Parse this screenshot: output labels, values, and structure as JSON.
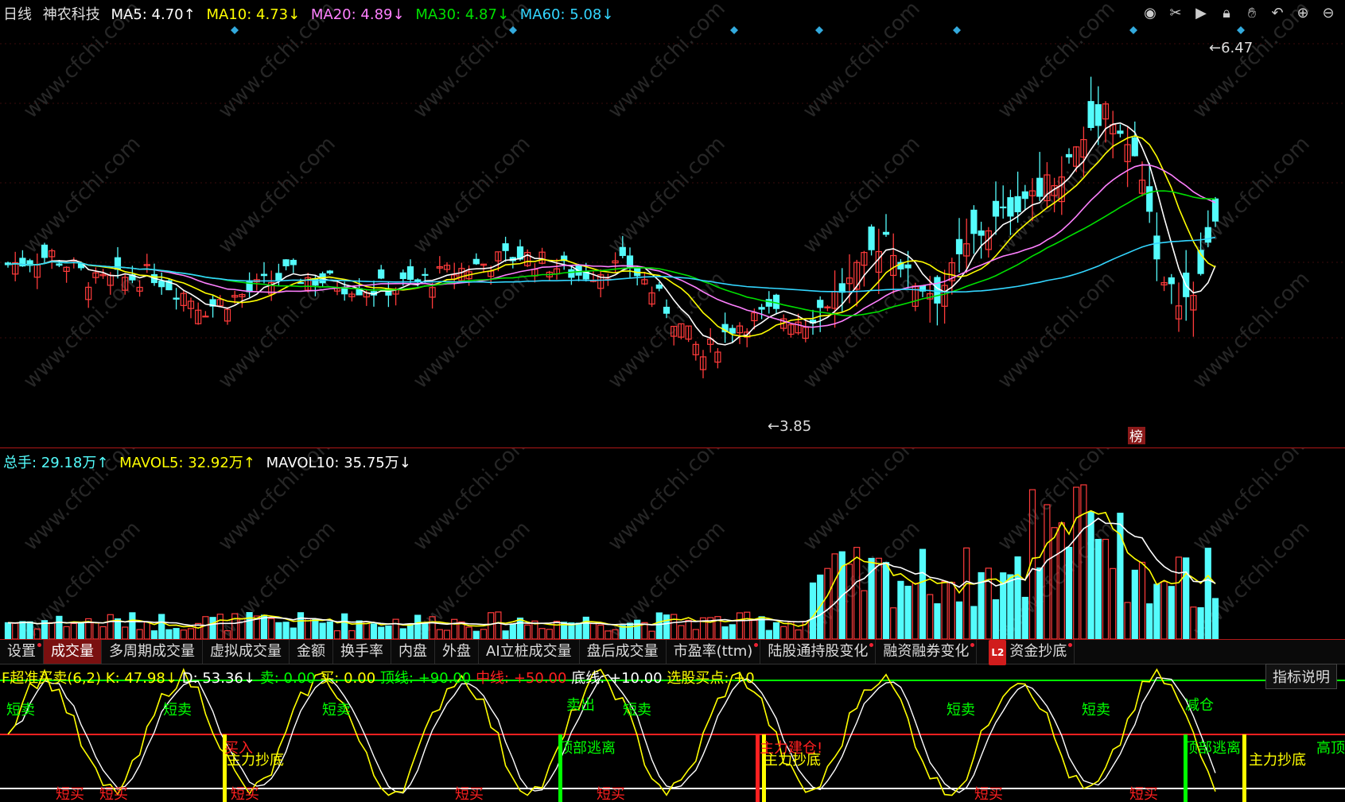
{
  "price_header": {
    "period": "日线",
    "stock_name": "神农科技",
    "ma5": "MA5: 4.70↑",
    "ma10": "MA10: 4.73↓",
    "ma20": "MA20: 4.89↓",
    "ma30": "MA30: 4.87↓",
    "ma60": "MA60: 5.08↓"
  },
  "price_annotations": {
    "high": "6.47",
    "low": "3.85",
    "badge": "榜"
  },
  "volume_header": {
    "total": "总手: 29.18万↑",
    "mavol5": "MAVOL5: 32.92万↑",
    "mavol10": "MAVOL10: 35.75万↓"
  },
  "toolbar_icons": [
    "eye-icon",
    "scissors-icon",
    "play-icon",
    "lock-icon",
    "hand-icon",
    "undo-icon",
    "zoom-in-icon",
    "zoom-out-icon"
  ],
  "tabs": [
    {
      "label": "设置",
      "dot": true,
      "active": false
    },
    {
      "label": "成交量",
      "dot": false,
      "active": true
    },
    {
      "label": "多周期成交量",
      "dot": false,
      "active": false
    },
    {
      "label": "虚拟成交量",
      "dot": false,
      "active": false
    },
    {
      "label": "金额",
      "dot": false,
      "active": false
    },
    {
      "label": "换手率",
      "dot": false,
      "active": false
    },
    {
      "label": "内盘",
      "dot": false,
      "active": false
    },
    {
      "label": "外盘",
      "dot": false,
      "active": false
    },
    {
      "label": "AI立桩成交量",
      "dot": false,
      "active": false
    },
    {
      "label": "盘后成交量",
      "dot": false,
      "active": false
    },
    {
      "label": "市盈率(ttm)",
      "dot": true,
      "active": false
    },
    {
      "label": "陆股通持股变化",
      "dot": true,
      "active": false
    },
    {
      "label": "融资融券变化",
      "dot": true,
      "active": false
    },
    {
      "label": "资金抄底",
      "dot": true,
      "active": false,
      "l2": true
    }
  ],
  "indicator_header": {
    "name": "F超准买卖(6,2)",
    "k": "K: 47.98↓",
    "d": "D: 53.36↓",
    "sell": "卖: 0.00",
    "buy": "买: 0.00",
    "top_line": "顶线: +90.00",
    "mid_line": "中线: +50.00",
    "bottom_line": "底线: +10.00",
    "pick_buy": "选股买点: +0",
    "explain_button": "指标说明"
  },
  "indicator_labels": {
    "short_sell": "短卖",
    "short_buy": "短买",
    "buy_in": "买入",
    "main_bottom": "主力抄底",
    "sell_out": "卖出",
    "reduce": "减仓",
    "add_position": "主力建仓!",
    "top_escape": "顶部逃离",
    "high_top": "高顶"
  },
  "watermark": "www.cfchi.com",
  "colors": {
    "up": "#ff3b3b",
    "down": "#54fcfc",
    "ma5": "#ffffff",
    "ma10": "#ffff00",
    "ma20": "#ff80ff",
    "ma30": "#00e000",
    "ma60": "#33d6ff",
    "green": "#00ff00",
    "red": "#ff2020"
  }
}
